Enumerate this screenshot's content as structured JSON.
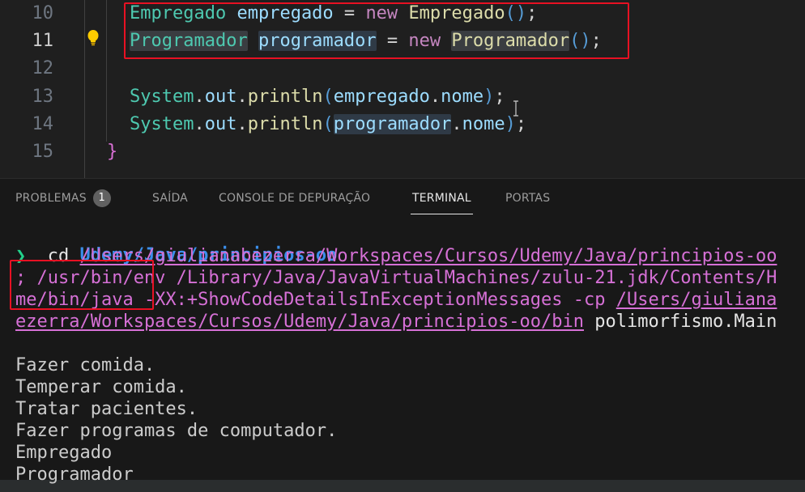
{
  "editor": {
    "lines": [
      {
        "num": "10"
      },
      {
        "num": "11"
      },
      {
        "num": "12"
      },
      {
        "num": "13"
      },
      {
        "num": "14"
      },
      {
        "num": "15"
      }
    ],
    "code": {
      "l10": {
        "type": "Empregado",
        "var": "empregado",
        "eq": " = ",
        "kw": "new",
        "ctor": "Empregado",
        "paren": "()",
        "semi": ";"
      },
      "l11": {
        "type": "Programador",
        "var": "programador",
        "eq": " = ",
        "kw": "new",
        "ctor": "Programador",
        "paren": "()",
        "semi": ";"
      },
      "l13": {
        "cls": "System",
        "dot1": ".",
        "field": "out",
        "dot2": ".",
        "fn": "println",
        "open": "(",
        "arg": "empregado",
        "dot3": ".",
        "member": "nome",
        "close": ")",
        "semi": ";"
      },
      "l14": {
        "cls": "System",
        "dot1": ".",
        "field": "out",
        "dot2": ".",
        "fn": "println",
        "open": "(",
        "arg": "programador",
        "dot3": ".",
        "member": "nome",
        "close": ")",
        "semi": ";"
      },
      "l15": {
        "brace": "}"
      }
    },
    "lightbulb_icon": "lightbulb-icon"
  },
  "panel": {
    "tabs": [
      {
        "label": "PROBLEMAS",
        "badge": "1"
      },
      {
        "label": "SAÍDA"
      },
      {
        "label": "CONSOLE DE DEPURAÇÃO"
      },
      {
        "label": "TERMINAL",
        "active": true
      },
      {
        "label": "PORTAS"
      }
    ],
    "terminal": {
      "cwd": "Udemy/Java/principios-oo",
      "prompt_symbol": "❯",
      "cmd": "cd",
      "path1": "/Users/giulianabezerra/Workspaces/Cursos/Udemy/Java/principios-oo",
      "line2_a": "; /usr/bin/env /Library/Java/JavaVirtualMachines/zulu-21.jdk/Contents/H",
      "line3_a": "me/bin/java -XX:+ShowCodeDetailsInExceptionMessages -cp ",
      "line3_b": "/Users/giuliana",
      "line4_a": "ezerra/Workspaces/Cursos/Udemy/Java/principios-oo/bin",
      "line4_b": " polimorfismo.Main",
      "output": [
        "Fazer comida.",
        "Temperar comida.",
        "Tratar pacientes.",
        "Fazer programas de computador.",
        "Empregado",
        "Programador"
      ]
    }
  },
  "colors": {
    "highlight_box": "#e81123",
    "keyword": "#c586c0",
    "type": "#4ec9b0",
    "variable": "#9cdcfe",
    "function": "#dcdcaa"
  }
}
